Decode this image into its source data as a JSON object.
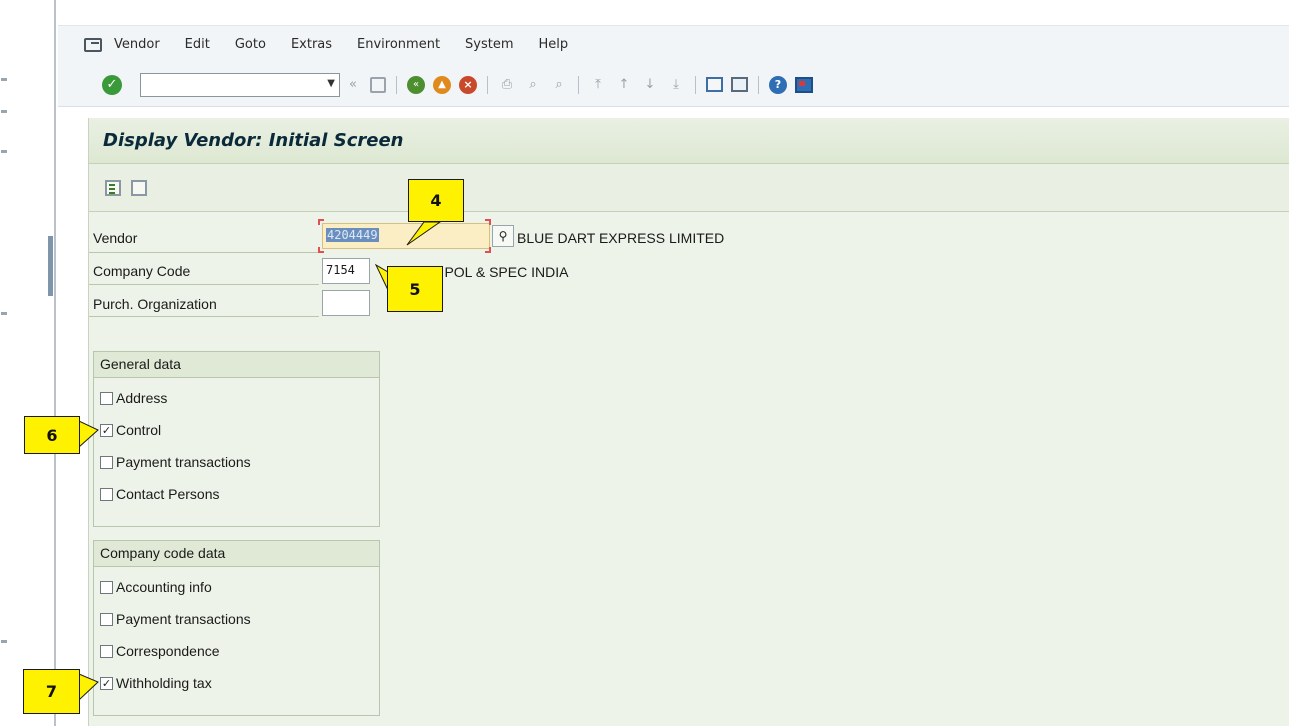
{
  "menu": {
    "items": [
      "Vendor",
      "Edit",
      "Goto",
      "Extras",
      "Environment",
      "System",
      "Help"
    ]
  },
  "toolbar": {
    "command_value": "",
    "icons": [
      "enter-icon",
      "command-dropdown-icon",
      "collapse-icon",
      "save-icon",
      "back-icon",
      "exit-icon",
      "cancel-icon",
      "print-icon",
      "find-icon",
      "find-next-icon",
      "first-page-icon",
      "previous-page-icon",
      "next-page-icon",
      "last-page-icon",
      "new-session-icon",
      "shortcut-icon",
      "help-icon",
      "customize-layout-icon"
    ]
  },
  "page": {
    "title": "Display Vendor: Initial Screen"
  },
  "form": {
    "vendor": {
      "label": "Vendor",
      "value": "4204449",
      "name": "BLUE DART EXPRESS LIMITED"
    },
    "company_code": {
      "label": "Company Code",
      "value": "7154",
      "name": "A POL & SPEC INDIA"
    },
    "purch_org": {
      "label": "Purch. Organization",
      "value": ""
    }
  },
  "general_data": {
    "title": "General data",
    "items": [
      {
        "label": "Address",
        "checked": false
      },
      {
        "label": "Control",
        "checked": true
      },
      {
        "label": "Payment transactions",
        "checked": false
      },
      {
        "label": "Contact Persons",
        "checked": false
      }
    ]
  },
  "company_code_data": {
    "title": "Company code data",
    "items": [
      {
        "label": "Accounting info",
        "checked": false
      },
      {
        "label": "Payment transactions",
        "checked": false
      },
      {
        "label": "Correspondence",
        "checked": false
      },
      {
        "label": "Withholding tax",
        "checked": true
      }
    ]
  },
  "callouts": [
    "4",
    "5",
    "6",
    "7"
  ],
  "colors": {
    "callout": "#fff200",
    "page_background": "#eef3e9",
    "vendor_field": "#fbeec4",
    "selection": "#6a8fbf"
  }
}
